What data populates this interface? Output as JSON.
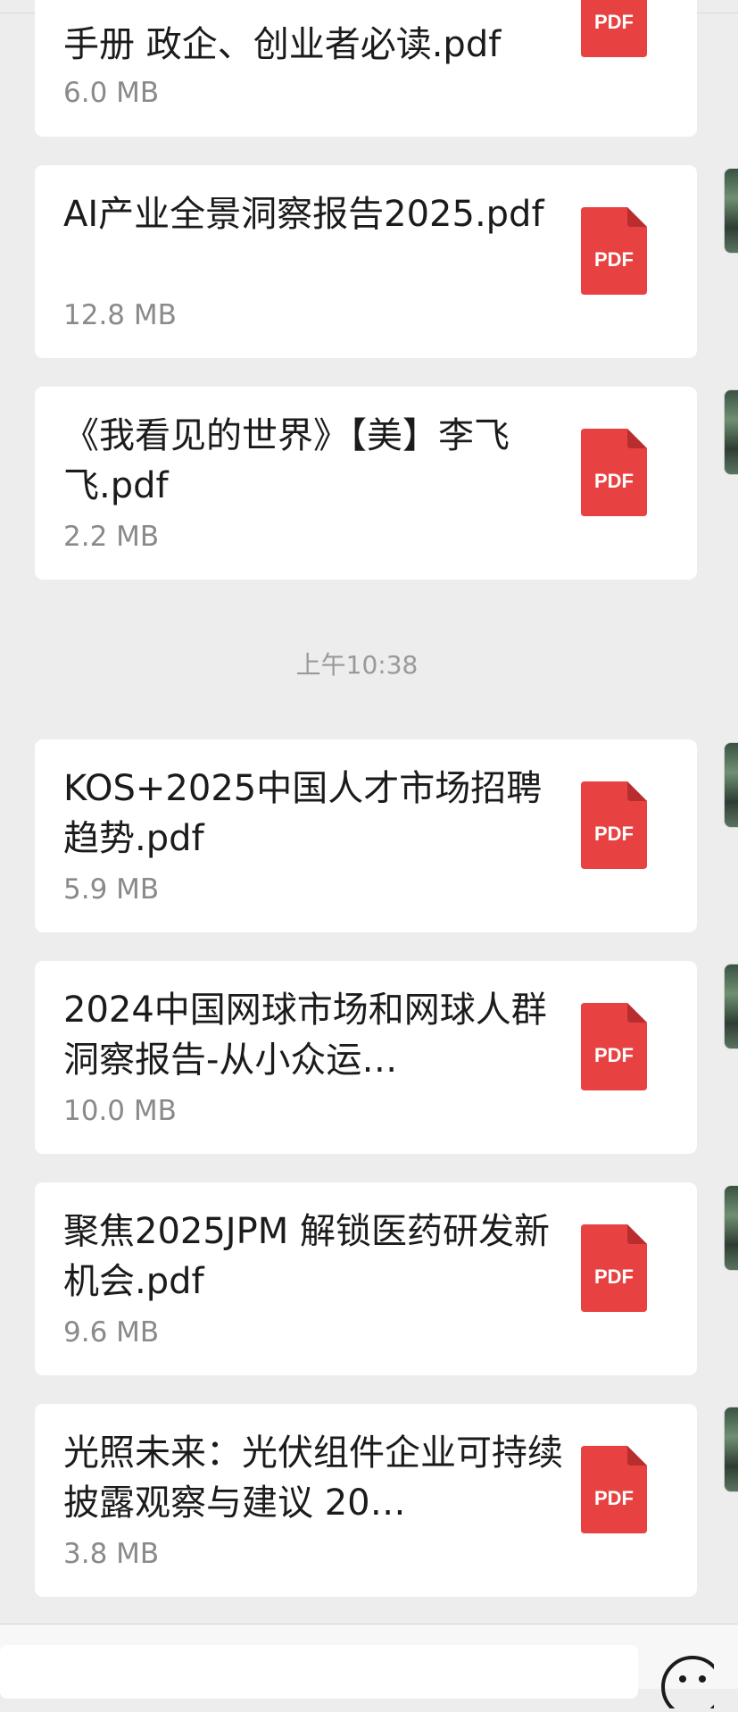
{
  "files": [
    {
      "name": "手册 政企、创业者必读.pdf",
      "size": "6.0 MB",
      "icon_label": "PDF"
    },
    {
      "name": "AI产业全景洞察报告2025.pdf",
      "size": "12.8 MB",
      "icon_label": "PDF"
    },
    {
      "name": "《我看见的世界》【美】李飞飞.pdf",
      "size": "2.2 MB",
      "icon_label": "PDF"
    },
    {
      "name": "KOS+2025中国人才市场招聘趋势.pdf",
      "size": "5.9 MB",
      "icon_label": "PDF"
    },
    {
      "name": "2024中国网球市场和网球人群洞察报告-从小众运…",
      "size": "10.0 MB",
      "icon_label": "PDF"
    },
    {
      "name": "聚焦2025JPM 解锁医药研发新机会.pdf",
      "size": "9.6 MB",
      "icon_label": "PDF"
    },
    {
      "name": "光照未来：光伏组件企业可持续披露观察与建议 20…",
      "size": "3.8 MB",
      "icon_label": "PDF"
    }
  ],
  "timestamp": "上午10:38",
  "colors": {
    "pdf_red": "#e84142",
    "pdf_fold": "#b82e2f",
    "background": "#ededed",
    "card": "#ffffff"
  },
  "icons": {
    "file": "pdf-file-icon",
    "emoji": "emoji-face-icon"
  }
}
